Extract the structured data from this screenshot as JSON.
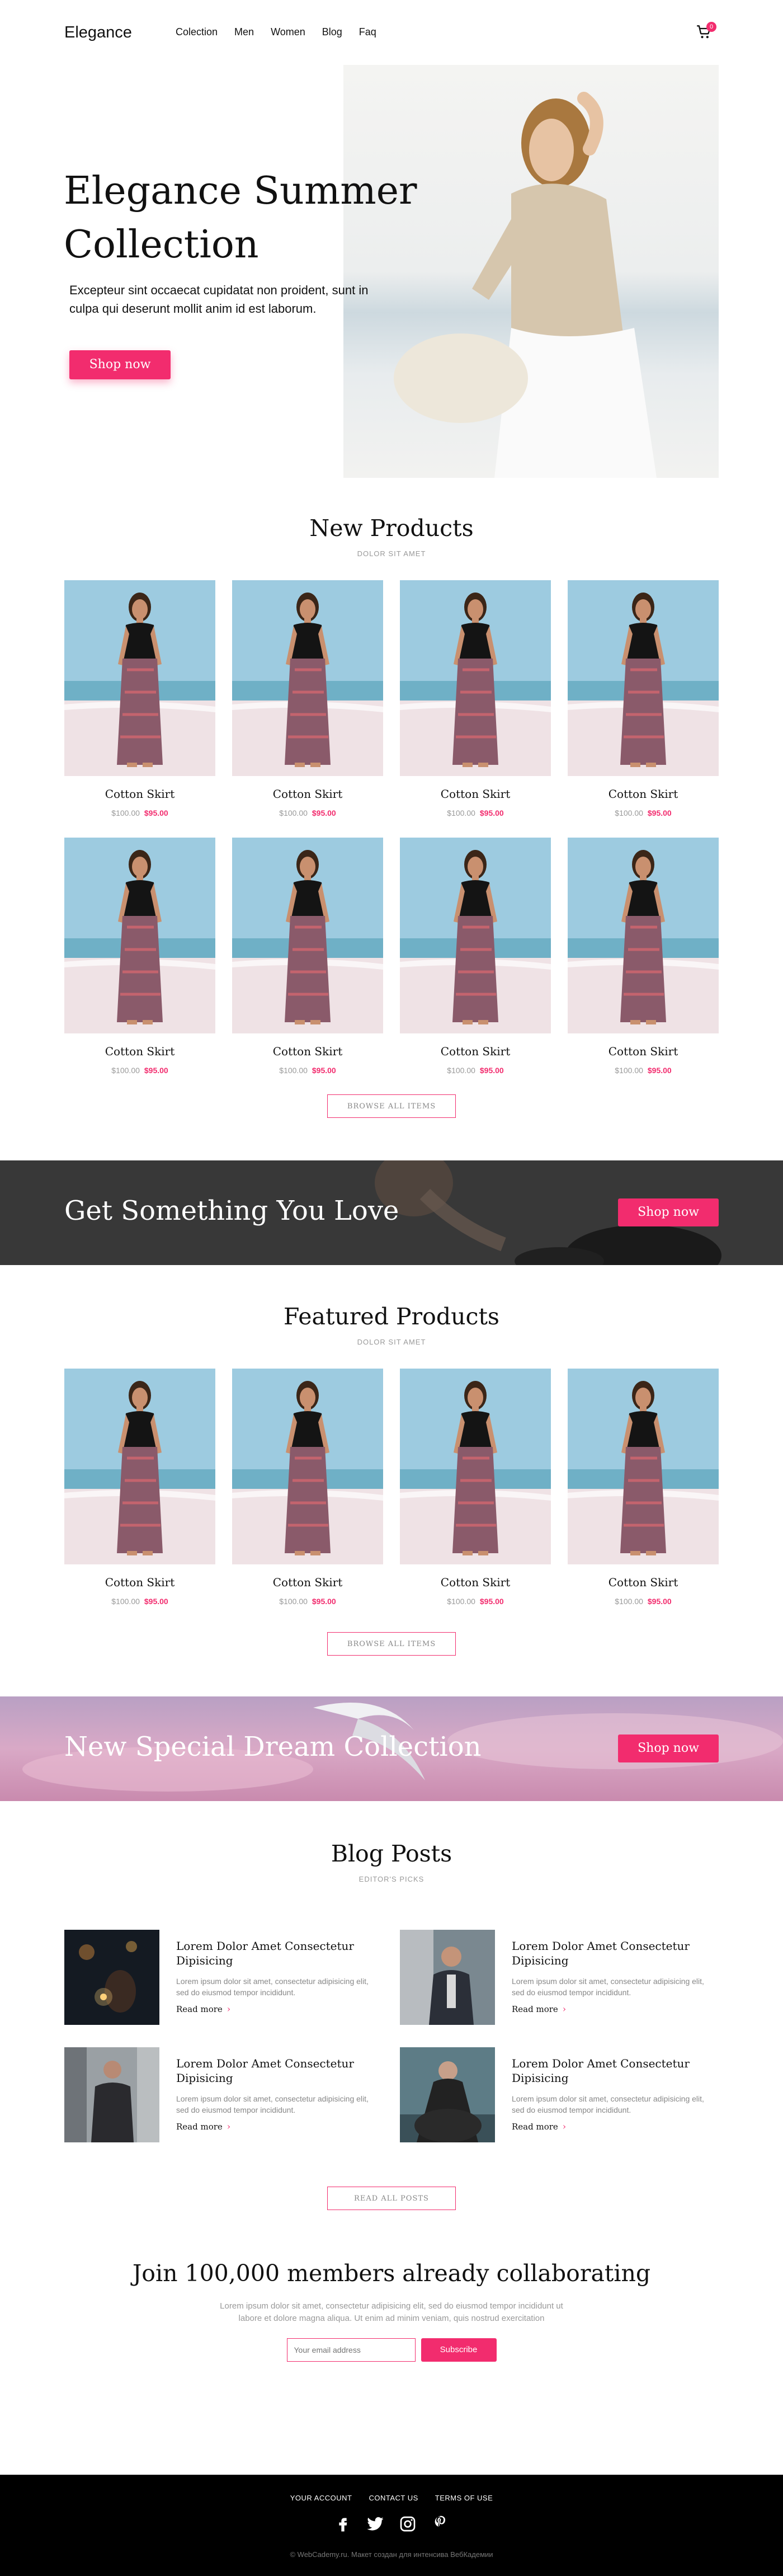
{
  "brand": {
    "logo": "Elegance",
    "accent": "#f22c6e"
  },
  "nav": {
    "items": [
      "Colection",
      "Men",
      "Women",
      "Blog",
      "Faq"
    ],
    "cart_count": "0"
  },
  "hero": {
    "title_line1": "Elegance Summer",
    "title_line2": "Collection",
    "text": "Excepteur sint occaecat cupidatat non proident, sunt in culpa qui deserunt mollit anim id est laborum.",
    "button": "Shop now"
  },
  "new_products": {
    "title": "New Products",
    "subtitle": "DOLOR SIT AMET",
    "items": [
      {
        "name": "Cotton Skirt",
        "old_price": "$100.00",
        "price": "$95.00"
      },
      {
        "name": "Cotton Skirt",
        "old_price": "$100.00",
        "price": "$95.00"
      },
      {
        "name": "Cotton Skirt",
        "old_price": "$100.00",
        "price": "$95.00"
      },
      {
        "name": "Cotton Skirt",
        "old_price": "$100.00",
        "price": "$95.00"
      },
      {
        "name": "Cotton Skirt",
        "old_price": "$100.00",
        "price": "$95.00"
      },
      {
        "name": "Cotton Skirt",
        "old_price": "$100.00",
        "price": "$95.00"
      },
      {
        "name": "Cotton Skirt",
        "old_price": "$100.00",
        "price": "$95.00"
      },
      {
        "name": "Cotton Skirt",
        "old_price": "$100.00",
        "price": "$95.00"
      }
    ],
    "browse": "BROWSE ALL ITEMS"
  },
  "banner1": {
    "title": "Get Something You Love",
    "button": "Shop now"
  },
  "featured_products": {
    "title": "Featured Products",
    "subtitle": "DOLOR SIT AMET",
    "items": [
      {
        "name": "Cotton Skirt",
        "old_price": "$100.00",
        "price": "$95.00"
      },
      {
        "name": "Cotton Skirt",
        "old_price": "$100.00",
        "price": "$95.00"
      },
      {
        "name": "Cotton Skirt",
        "old_price": "$100.00",
        "price": "$95.00"
      },
      {
        "name": "Cotton Skirt",
        "old_price": "$100.00",
        "price": "$95.00"
      }
    ],
    "browse": "BROWSE ALL ITEMS"
  },
  "banner2": {
    "title": "New Special Dream Collection",
    "button": "Shop now"
  },
  "blog": {
    "title": "Blog Posts",
    "subtitle": "EDITOR'S PICKS",
    "posts": [
      {
        "title": "Lorem Dolor Amet Consectetur Dipisicing",
        "text": "Lorem ipsum dolor sit amet, consectetur adipisicing elit, sed do eiusmod tempor incididunt.",
        "more": "Read more"
      },
      {
        "title": "Lorem Dolor Amet Consectetur Dipisicing",
        "text": "Lorem ipsum dolor sit amet, consectetur adipisicing elit, sed do eiusmod tempor incididunt.",
        "more": "Read more"
      },
      {
        "title": "Lorem Dolor Amet Consectetur Dipisicing",
        "text": "Lorem ipsum dolor sit amet, consectetur adipisicing elit, sed do eiusmod tempor incididunt.",
        "more": "Read more"
      },
      {
        "title": "Lorem Dolor Amet Consectetur Dipisicing",
        "text": "Lorem ipsum dolor sit amet, consectetur adipisicing elit, sed do eiusmod tempor incididunt.",
        "more": "Read more"
      }
    ],
    "read_all": "READ ALL POSTS"
  },
  "newsletter": {
    "title": "Join 100,000 members already collaborating",
    "text": "Lorem ipsum dolor sit amet, consectetur adipisicing elit, sed do eiusmod tempor incididunt ut labore et dolore magna aliqua. Ut enim ad minim veniam, quis nostrud exercitation",
    "placeholder": "Your email address",
    "button": "Subscribe"
  },
  "footer": {
    "links": [
      "YOUR ACCOUNT",
      "CONTACT US",
      "TERMS OF USE"
    ],
    "socials": [
      "facebook-icon",
      "twitter-icon",
      "instagram-icon",
      "pinterest-icon"
    ],
    "copyright": "© WebCademy.ru. Макет создан для интенсива ВебКадемии"
  }
}
